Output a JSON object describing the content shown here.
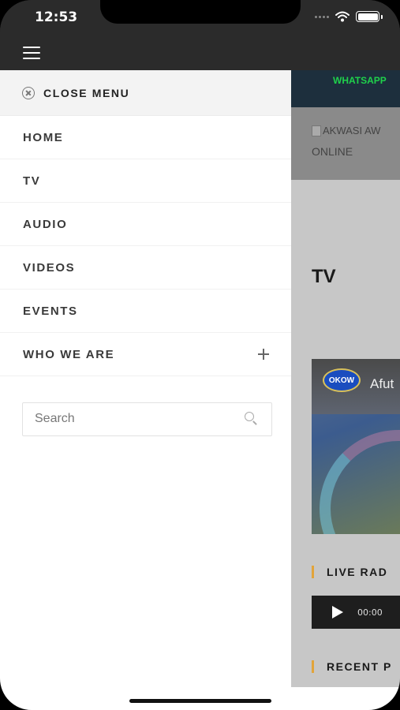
{
  "status_bar": {
    "time": "12:53"
  },
  "app_header": {
    "menu_icon": "hamburger-icon"
  },
  "drawer": {
    "close_label": "CLOSE MENU",
    "items": [
      {
        "label": "HOME"
      },
      {
        "label": "TV"
      },
      {
        "label": "AUDIO"
      },
      {
        "label": "VIDEOS"
      },
      {
        "label": "EVENTS"
      },
      {
        "label": "WHO WE ARE",
        "expandable": true
      }
    ],
    "search": {
      "placeholder": "Search",
      "value": ""
    }
  },
  "page": {
    "whatsapp_text": "WHATSAPP",
    "banner_alt": "AKWASI AW",
    "banner_line2": "ONLINE",
    "section_title": "TV",
    "video": {
      "logo_text": "OKOW",
      "title": "Afut"
    },
    "live_radio_heading": "LIVE RAD",
    "audio_time": "00:00",
    "recent_heading": "RECENT P"
  },
  "colors": {
    "header_bg": "#2b2b2b",
    "whatsapp_green": "#1fd14b",
    "section_accent": "#e2a43a",
    "drawer_bg": "#ffffff"
  }
}
